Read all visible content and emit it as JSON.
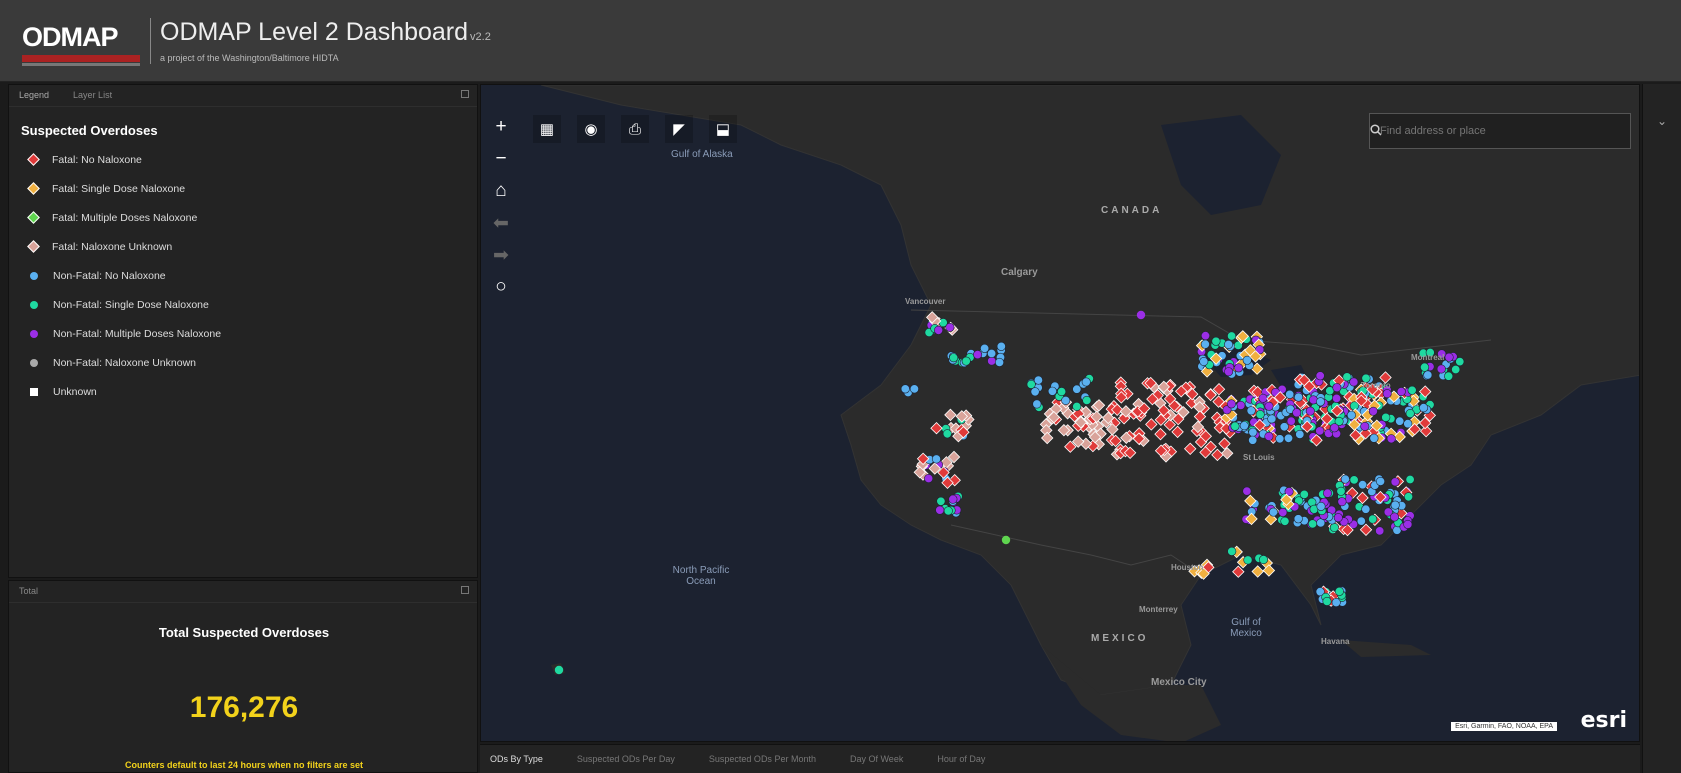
{
  "header": {
    "logo": "ODMAP",
    "title": "ODMAP Level 2 Dashboard",
    "version": "v2.2",
    "subtitle": "a project of the Washington/Baltimore HIDTA"
  },
  "legend_panel": {
    "tabs": [
      "Legend",
      "Layer List"
    ],
    "title": "Suspected Overdoses",
    "items": [
      {
        "label": "Fatal: No Naloxone",
        "shape": "diamond",
        "color": "#e03a3a"
      },
      {
        "label": "Fatal: Single Dose Naloxone",
        "shape": "diamond",
        "color": "#f0b040"
      },
      {
        "label": "Fatal: Multiple Doses Naloxone",
        "shape": "diamond",
        "color": "#5fd54f"
      },
      {
        "label": "Fatal: Naloxone Unknown",
        "shape": "diamond",
        "color": "#d9a39a"
      },
      {
        "label": "Non-Fatal: No Naloxone",
        "shape": "circle",
        "color": "#5ab0f0"
      },
      {
        "label": "Non-Fatal: Single Dose Naloxone",
        "shape": "circle",
        "color": "#1fd9a0"
      },
      {
        "label": "Non-Fatal: Multiple Doses Naloxone",
        "shape": "circle",
        "color": "#9b2ee6"
      },
      {
        "label": "Non-Fatal: Naloxone Unknown",
        "shape": "circle",
        "color": "#aaaaaa"
      },
      {
        "label": "Unknown",
        "shape": "square",
        "color": "#ffffff"
      }
    ]
  },
  "total_panel": {
    "tab": "Total",
    "title": "Total Suspected Overdoses",
    "value": "176,276",
    "note": "Counters default to last 24 hours when no filters are set"
  },
  "map": {
    "search_placeholder": "Find address or place",
    "labels": {
      "gulf_of_alaska": "Gulf of Alaska",
      "canada": "CANADA",
      "calgary": "Calgary",
      "vancouver": "Vancouver",
      "north_pacific_ocean": "North Pacific Ocean",
      "mexico": "MEXICO",
      "mexico_city": "Mexico City",
      "gulf_of_mexico": "Gulf of Mexico",
      "havana": "Havana",
      "houston": "Houston",
      "montreal": "Montreal",
      "toronto": "Toronto",
      "st_louis": "St Louis",
      "monterrey": "Monterrey"
    },
    "attribution": "Esri, Garmin, FAO, NOAA, EPA",
    "brand": "esri"
  },
  "bottom_tabs": [
    "ODs By Type",
    "Suspected ODs Per Day",
    "Suspected ODs Per Month",
    "Day Of Week",
    "Hour of Day"
  ],
  "colors": {
    "accent_yellow": "#f2d21b",
    "header_bg": "#3a3a3a",
    "map_water": "#1c2230",
    "map_land": "#2b2b2b"
  }
}
